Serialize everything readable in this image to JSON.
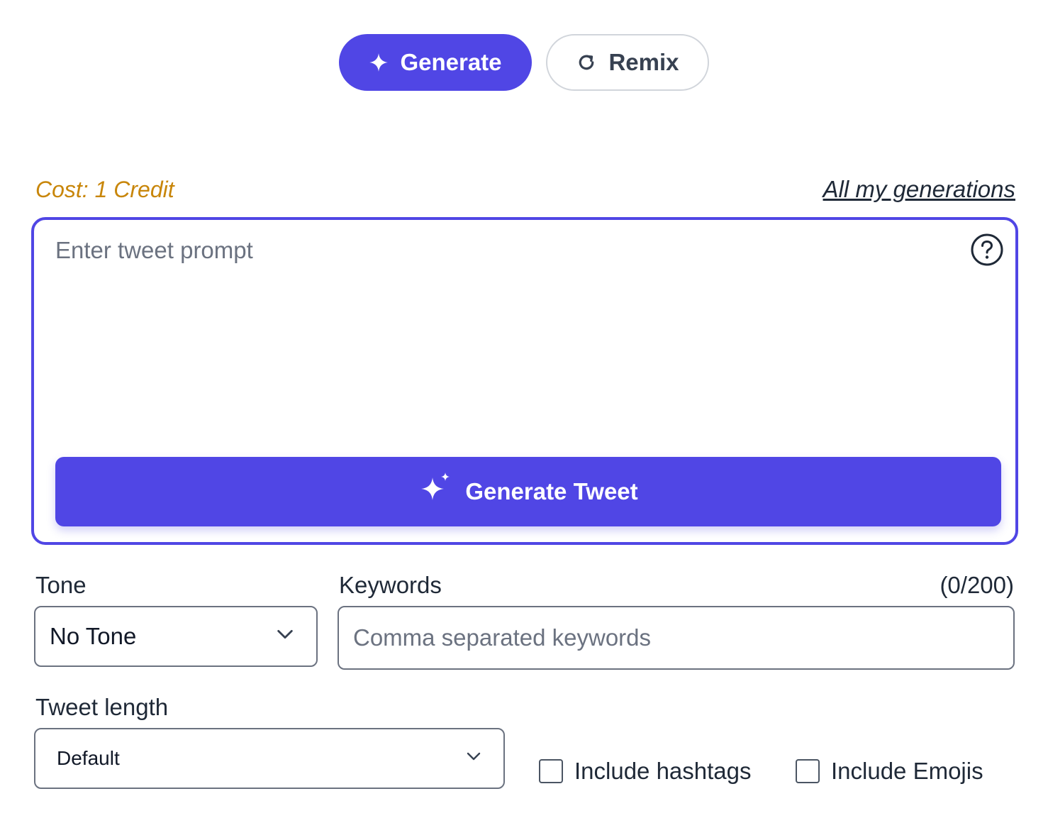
{
  "mode_buttons": {
    "generate": {
      "label": "Generate",
      "icon": "sparkle-icon"
    },
    "remix": {
      "label": "Remix",
      "icon": "refresh-icon"
    }
  },
  "meta": {
    "cost": "Cost: 1 Credit",
    "generations_link": "All my generations"
  },
  "prompt": {
    "placeholder": "Enter tweet prompt",
    "value": "",
    "help_icon": "question-circle-icon",
    "submit_label": "Generate Tweet",
    "submit_icon": "sparkles-icon"
  },
  "tone": {
    "label": "Tone",
    "selected": "No Tone"
  },
  "keywords": {
    "label": "Keywords",
    "counter": "(0/200)",
    "placeholder": "Comma separated keywords",
    "value": ""
  },
  "tweet_length": {
    "label": "Tweet length",
    "selected": "Default"
  },
  "options": {
    "hashtags": {
      "label": "Include hashtags",
      "checked": false
    },
    "emojis": {
      "label": "Include Emojis",
      "checked": false
    }
  },
  "colors": {
    "accent": "#5046e5",
    "cost_text": "#c8860a",
    "border": "#6b7280"
  }
}
